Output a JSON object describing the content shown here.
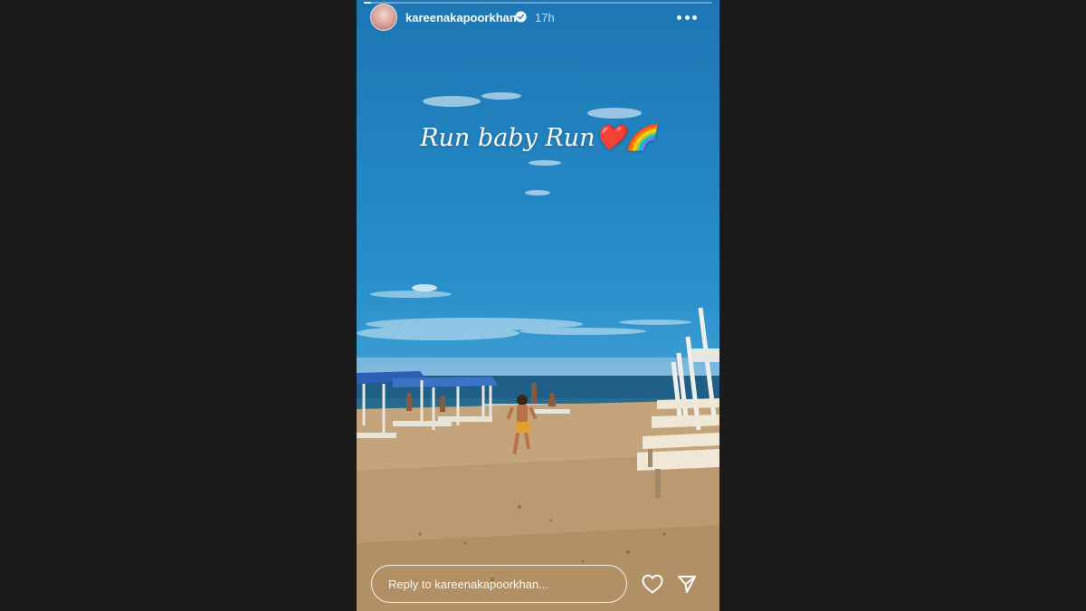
{
  "story": {
    "progress": 0.02,
    "user": {
      "username": "kareenakapoorkhan",
      "verified": true,
      "time_ago": "17h",
      "avatar": "profile-photo"
    },
    "caption": "Run baby Run❤️🌈",
    "reply": {
      "placeholder": "Reply to kareenakapoorkhan..."
    },
    "icons": {
      "more": "more-dots-icon",
      "like": "heart-icon",
      "share": "send-icon",
      "verified": "verified-badge-icon"
    }
  },
  "colors": {
    "page_background": "#1a1a1a",
    "sky": "#2386c2",
    "sand": "#c4a47b",
    "sea": "#1e5f86"
  }
}
